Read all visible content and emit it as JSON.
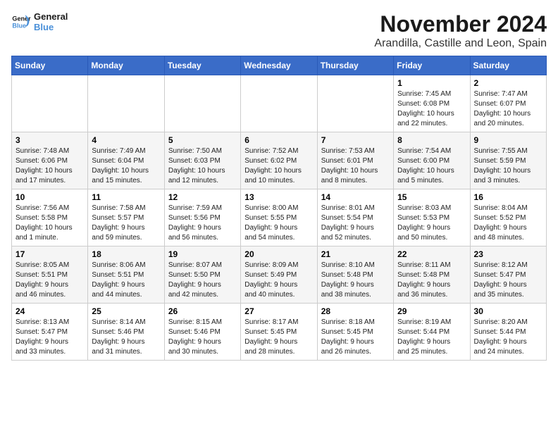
{
  "logo": {
    "line1": "General",
    "line2": "Blue"
  },
  "title": "November 2024",
  "location": "Arandilla, Castille and Leon, Spain",
  "weekdays": [
    "Sunday",
    "Monday",
    "Tuesday",
    "Wednesday",
    "Thursday",
    "Friday",
    "Saturday"
  ],
  "weeks": [
    [
      {
        "day": "",
        "info": ""
      },
      {
        "day": "",
        "info": ""
      },
      {
        "day": "",
        "info": ""
      },
      {
        "day": "",
        "info": ""
      },
      {
        "day": "",
        "info": ""
      },
      {
        "day": "1",
        "info": "Sunrise: 7:45 AM\nSunset: 6:08 PM\nDaylight: 10 hours\nand 22 minutes."
      },
      {
        "day": "2",
        "info": "Sunrise: 7:47 AM\nSunset: 6:07 PM\nDaylight: 10 hours\nand 20 minutes."
      }
    ],
    [
      {
        "day": "3",
        "info": "Sunrise: 7:48 AM\nSunset: 6:06 PM\nDaylight: 10 hours\nand 17 minutes."
      },
      {
        "day": "4",
        "info": "Sunrise: 7:49 AM\nSunset: 6:04 PM\nDaylight: 10 hours\nand 15 minutes."
      },
      {
        "day": "5",
        "info": "Sunrise: 7:50 AM\nSunset: 6:03 PM\nDaylight: 10 hours\nand 12 minutes."
      },
      {
        "day": "6",
        "info": "Sunrise: 7:52 AM\nSunset: 6:02 PM\nDaylight: 10 hours\nand 10 minutes."
      },
      {
        "day": "7",
        "info": "Sunrise: 7:53 AM\nSunset: 6:01 PM\nDaylight: 10 hours\nand 8 minutes."
      },
      {
        "day": "8",
        "info": "Sunrise: 7:54 AM\nSunset: 6:00 PM\nDaylight: 10 hours\nand 5 minutes."
      },
      {
        "day": "9",
        "info": "Sunrise: 7:55 AM\nSunset: 5:59 PM\nDaylight: 10 hours\nand 3 minutes."
      }
    ],
    [
      {
        "day": "10",
        "info": "Sunrise: 7:56 AM\nSunset: 5:58 PM\nDaylight: 10 hours\nand 1 minute."
      },
      {
        "day": "11",
        "info": "Sunrise: 7:58 AM\nSunset: 5:57 PM\nDaylight: 9 hours\nand 59 minutes."
      },
      {
        "day": "12",
        "info": "Sunrise: 7:59 AM\nSunset: 5:56 PM\nDaylight: 9 hours\nand 56 minutes."
      },
      {
        "day": "13",
        "info": "Sunrise: 8:00 AM\nSunset: 5:55 PM\nDaylight: 9 hours\nand 54 minutes."
      },
      {
        "day": "14",
        "info": "Sunrise: 8:01 AM\nSunset: 5:54 PM\nDaylight: 9 hours\nand 52 minutes."
      },
      {
        "day": "15",
        "info": "Sunrise: 8:03 AM\nSunset: 5:53 PM\nDaylight: 9 hours\nand 50 minutes."
      },
      {
        "day": "16",
        "info": "Sunrise: 8:04 AM\nSunset: 5:52 PM\nDaylight: 9 hours\nand 48 minutes."
      }
    ],
    [
      {
        "day": "17",
        "info": "Sunrise: 8:05 AM\nSunset: 5:51 PM\nDaylight: 9 hours\nand 46 minutes."
      },
      {
        "day": "18",
        "info": "Sunrise: 8:06 AM\nSunset: 5:51 PM\nDaylight: 9 hours\nand 44 minutes."
      },
      {
        "day": "19",
        "info": "Sunrise: 8:07 AM\nSunset: 5:50 PM\nDaylight: 9 hours\nand 42 minutes."
      },
      {
        "day": "20",
        "info": "Sunrise: 8:09 AM\nSunset: 5:49 PM\nDaylight: 9 hours\nand 40 minutes."
      },
      {
        "day": "21",
        "info": "Sunrise: 8:10 AM\nSunset: 5:48 PM\nDaylight: 9 hours\nand 38 minutes."
      },
      {
        "day": "22",
        "info": "Sunrise: 8:11 AM\nSunset: 5:48 PM\nDaylight: 9 hours\nand 36 minutes."
      },
      {
        "day": "23",
        "info": "Sunrise: 8:12 AM\nSunset: 5:47 PM\nDaylight: 9 hours\nand 35 minutes."
      }
    ],
    [
      {
        "day": "24",
        "info": "Sunrise: 8:13 AM\nSunset: 5:47 PM\nDaylight: 9 hours\nand 33 minutes."
      },
      {
        "day": "25",
        "info": "Sunrise: 8:14 AM\nSunset: 5:46 PM\nDaylight: 9 hours\nand 31 minutes."
      },
      {
        "day": "26",
        "info": "Sunrise: 8:15 AM\nSunset: 5:46 PM\nDaylight: 9 hours\nand 30 minutes."
      },
      {
        "day": "27",
        "info": "Sunrise: 8:17 AM\nSunset: 5:45 PM\nDaylight: 9 hours\nand 28 minutes."
      },
      {
        "day": "28",
        "info": "Sunrise: 8:18 AM\nSunset: 5:45 PM\nDaylight: 9 hours\nand 26 minutes."
      },
      {
        "day": "29",
        "info": "Sunrise: 8:19 AM\nSunset: 5:44 PM\nDaylight: 9 hours\nand 25 minutes."
      },
      {
        "day": "30",
        "info": "Sunrise: 8:20 AM\nSunset: 5:44 PM\nDaylight: 9 hours\nand 24 minutes."
      }
    ]
  ]
}
